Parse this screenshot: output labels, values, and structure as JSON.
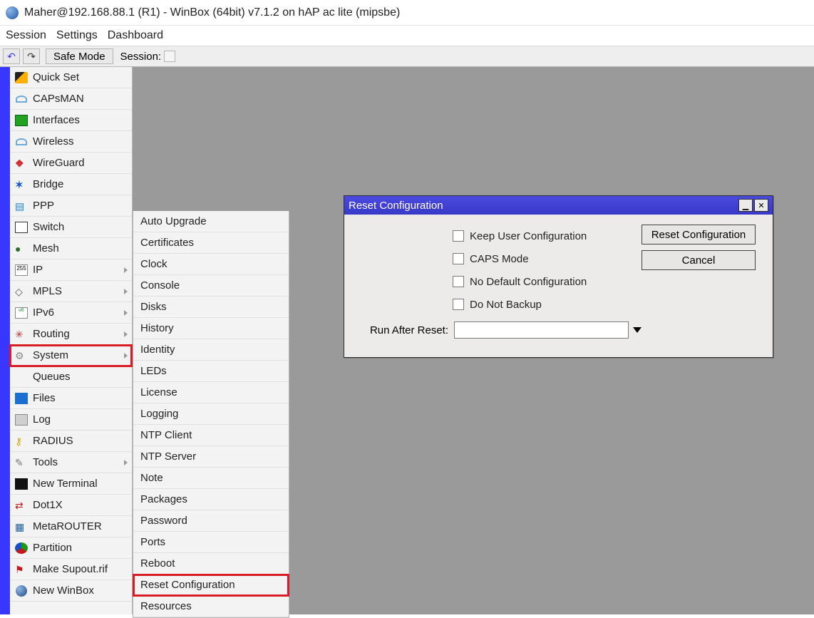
{
  "window": {
    "title": "Maher@192.168.88.1 (R1) - WinBox (64bit) v7.1.2 on hAP ac lite (mipsbe)"
  },
  "menubar": [
    "Session",
    "Settings",
    "Dashboard"
  ],
  "toolbar": {
    "undo_glyph": "↶",
    "redo_glyph": "↷",
    "safe_mode": "Safe Mode",
    "session_label": "Session:"
  },
  "sidebar": [
    {
      "name": "quick-set",
      "label": "Quick Set",
      "icon": "wand"
    },
    {
      "name": "capsman",
      "label": "CAPsMAN",
      "icon": "caps"
    },
    {
      "name": "interfaces",
      "label": "Interfaces",
      "icon": "iface"
    },
    {
      "name": "wireless",
      "label": "Wireless",
      "icon": "wifi"
    },
    {
      "name": "wireguard",
      "label": "WireGuard",
      "icon": "wg"
    },
    {
      "name": "bridge",
      "label": "Bridge",
      "icon": "bridge"
    },
    {
      "name": "ppp",
      "label": "PPP",
      "icon": "ppp"
    },
    {
      "name": "switch",
      "label": "Switch",
      "icon": "switch"
    },
    {
      "name": "mesh",
      "label": "Mesh",
      "icon": "mesh"
    },
    {
      "name": "ip",
      "label": "IP",
      "icon": "ip",
      "submenu": true
    },
    {
      "name": "mpls",
      "label": "MPLS",
      "icon": "mpls",
      "submenu": true
    },
    {
      "name": "ipv6",
      "label": "IPv6",
      "icon": "ipv6",
      "submenu": true
    },
    {
      "name": "routing",
      "label": "Routing",
      "icon": "route",
      "submenu": true
    },
    {
      "name": "system",
      "label": "System",
      "icon": "sys",
      "submenu": true,
      "highlight": true
    },
    {
      "name": "queues",
      "label": "Queues",
      "icon": "queue"
    },
    {
      "name": "files",
      "label": "Files",
      "icon": "files"
    },
    {
      "name": "log",
      "label": "Log",
      "icon": "log"
    },
    {
      "name": "radius",
      "label": "RADIUS",
      "icon": "radius"
    },
    {
      "name": "tools",
      "label": "Tools",
      "icon": "tools",
      "submenu": true
    },
    {
      "name": "new-terminal",
      "label": "New Terminal",
      "icon": "term"
    },
    {
      "name": "dot1x",
      "label": "Dot1X",
      "icon": "dot1x"
    },
    {
      "name": "metarouter",
      "label": "MetaROUTER",
      "icon": "meta"
    },
    {
      "name": "partition",
      "label": "Partition",
      "icon": "part"
    },
    {
      "name": "make-supout",
      "label": "Make Supout.rif",
      "icon": "supout"
    },
    {
      "name": "new-winbox",
      "label": "New WinBox",
      "icon": "globe2"
    }
  ],
  "submenu": {
    "items": [
      {
        "label": "Auto Upgrade"
      },
      {
        "label": "Certificates"
      },
      {
        "label": "Clock"
      },
      {
        "label": "Console"
      },
      {
        "label": "Disks"
      },
      {
        "label": "History"
      },
      {
        "label": "Identity"
      },
      {
        "label": "LEDs"
      },
      {
        "label": "License"
      },
      {
        "label": "Logging"
      },
      {
        "label": "NTP Client"
      },
      {
        "label": "NTP Server"
      },
      {
        "label": "Note"
      },
      {
        "label": "Packages"
      },
      {
        "label": "Password"
      },
      {
        "label": "Ports"
      },
      {
        "label": "Reboot"
      },
      {
        "label": "Reset Configuration",
        "highlight": true
      },
      {
        "label": "Resources"
      }
    ]
  },
  "dialog": {
    "title": "Reset Configuration",
    "checkboxes": [
      {
        "label": "Keep User Configuration"
      },
      {
        "label": "CAPS Mode"
      },
      {
        "label": "No Default Configuration"
      },
      {
        "label": "Do Not Backup"
      }
    ],
    "run_after_label": "Run After Reset:",
    "run_after_value": "",
    "buttons": {
      "ok": "Reset Configuration",
      "cancel": "Cancel"
    },
    "win_min": "▁",
    "win_close": "✕"
  }
}
